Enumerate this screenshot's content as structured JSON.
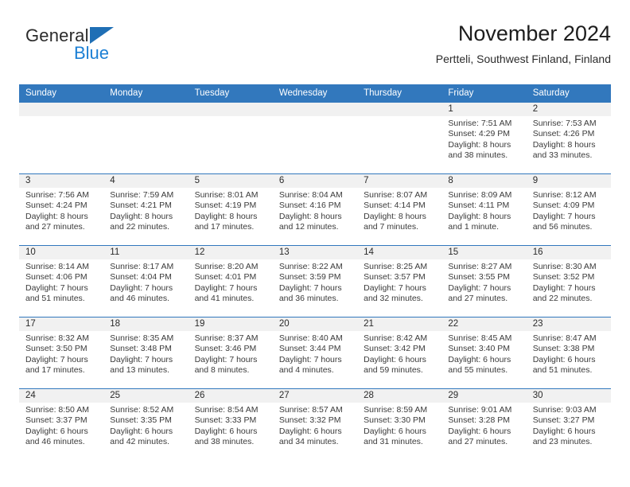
{
  "brand": {
    "name_part1": "General",
    "name_part2": "Blue",
    "accent_color": "#1b7fd4",
    "triangle_color": "#1f6fb5"
  },
  "header": {
    "title": "November 2024",
    "subtitle": "Pertteli, Southwest Finland, Finland"
  },
  "calendar": {
    "header_bg": "#3278bd",
    "day_band_bg": "#f1f1f1",
    "weekdays": [
      "Sunday",
      "Monday",
      "Tuesday",
      "Wednesday",
      "Thursday",
      "Friday",
      "Saturday"
    ],
    "weeks": [
      [
        {
          "day": "",
          "sunrise": "",
          "sunset": "",
          "daylight": ""
        },
        {
          "day": "",
          "sunrise": "",
          "sunset": "",
          "daylight": ""
        },
        {
          "day": "",
          "sunrise": "",
          "sunset": "",
          "daylight": ""
        },
        {
          "day": "",
          "sunrise": "",
          "sunset": "",
          "daylight": ""
        },
        {
          "day": "",
          "sunrise": "",
          "sunset": "",
          "daylight": ""
        },
        {
          "day": "1",
          "sunrise": "Sunrise: 7:51 AM",
          "sunset": "Sunset: 4:29 PM",
          "daylight": "Daylight: 8 hours and 38 minutes."
        },
        {
          "day": "2",
          "sunrise": "Sunrise: 7:53 AM",
          "sunset": "Sunset: 4:26 PM",
          "daylight": "Daylight: 8 hours and 33 minutes."
        }
      ],
      [
        {
          "day": "3",
          "sunrise": "Sunrise: 7:56 AM",
          "sunset": "Sunset: 4:24 PM",
          "daylight": "Daylight: 8 hours and 27 minutes."
        },
        {
          "day": "4",
          "sunrise": "Sunrise: 7:59 AM",
          "sunset": "Sunset: 4:21 PM",
          "daylight": "Daylight: 8 hours and 22 minutes."
        },
        {
          "day": "5",
          "sunrise": "Sunrise: 8:01 AM",
          "sunset": "Sunset: 4:19 PM",
          "daylight": "Daylight: 8 hours and 17 minutes."
        },
        {
          "day": "6",
          "sunrise": "Sunrise: 8:04 AM",
          "sunset": "Sunset: 4:16 PM",
          "daylight": "Daylight: 8 hours and 12 minutes."
        },
        {
          "day": "7",
          "sunrise": "Sunrise: 8:07 AM",
          "sunset": "Sunset: 4:14 PM",
          "daylight": "Daylight: 8 hours and 7 minutes."
        },
        {
          "day": "8",
          "sunrise": "Sunrise: 8:09 AM",
          "sunset": "Sunset: 4:11 PM",
          "daylight": "Daylight: 8 hours and 1 minute."
        },
        {
          "day": "9",
          "sunrise": "Sunrise: 8:12 AM",
          "sunset": "Sunset: 4:09 PM",
          "daylight": "Daylight: 7 hours and 56 minutes."
        }
      ],
      [
        {
          "day": "10",
          "sunrise": "Sunrise: 8:14 AM",
          "sunset": "Sunset: 4:06 PM",
          "daylight": "Daylight: 7 hours and 51 minutes."
        },
        {
          "day": "11",
          "sunrise": "Sunrise: 8:17 AM",
          "sunset": "Sunset: 4:04 PM",
          "daylight": "Daylight: 7 hours and 46 minutes."
        },
        {
          "day": "12",
          "sunrise": "Sunrise: 8:20 AM",
          "sunset": "Sunset: 4:01 PM",
          "daylight": "Daylight: 7 hours and 41 minutes."
        },
        {
          "day": "13",
          "sunrise": "Sunrise: 8:22 AM",
          "sunset": "Sunset: 3:59 PM",
          "daylight": "Daylight: 7 hours and 36 minutes."
        },
        {
          "day": "14",
          "sunrise": "Sunrise: 8:25 AM",
          "sunset": "Sunset: 3:57 PM",
          "daylight": "Daylight: 7 hours and 32 minutes."
        },
        {
          "day": "15",
          "sunrise": "Sunrise: 8:27 AM",
          "sunset": "Sunset: 3:55 PM",
          "daylight": "Daylight: 7 hours and 27 minutes."
        },
        {
          "day": "16",
          "sunrise": "Sunrise: 8:30 AM",
          "sunset": "Sunset: 3:52 PM",
          "daylight": "Daylight: 7 hours and 22 minutes."
        }
      ],
      [
        {
          "day": "17",
          "sunrise": "Sunrise: 8:32 AM",
          "sunset": "Sunset: 3:50 PM",
          "daylight": "Daylight: 7 hours and 17 minutes."
        },
        {
          "day": "18",
          "sunrise": "Sunrise: 8:35 AM",
          "sunset": "Sunset: 3:48 PM",
          "daylight": "Daylight: 7 hours and 13 minutes."
        },
        {
          "day": "19",
          "sunrise": "Sunrise: 8:37 AM",
          "sunset": "Sunset: 3:46 PM",
          "daylight": "Daylight: 7 hours and 8 minutes."
        },
        {
          "day": "20",
          "sunrise": "Sunrise: 8:40 AM",
          "sunset": "Sunset: 3:44 PM",
          "daylight": "Daylight: 7 hours and 4 minutes."
        },
        {
          "day": "21",
          "sunrise": "Sunrise: 8:42 AM",
          "sunset": "Sunset: 3:42 PM",
          "daylight": "Daylight: 6 hours and 59 minutes."
        },
        {
          "day": "22",
          "sunrise": "Sunrise: 8:45 AM",
          "sunset": "Sunset: 3:40 PM",
          "daylight": "Daylight: 6 hours and 55 minutes."
        },
        {
          "day": "23",
          "sunrise": "Sunrise: 8:47 AM",
          "sunset": "Sunset: 3:38 PM",
          "daylight": "Daylight: 6 hours and 51 minutes."
        }
      ],
      [
        {
          "day": "24",
          "sunrise": "Sunrise: 8:50 AM",
          "sunset": "Sunset: 3:37 PM",
          "daylight": "Daylight: 6 hours and 46 minutes."
        },
        {
          "day": "25",
          "sunrise": "Sunrise: 8:52 AM",
          "sunset": "Sunset: 3:35 PM",
          "daylight": "Daylight: 6 hours and 42 minutes."
        },
        {
          "day": "26",
          "sunrise": "Sunrise: 8:54 AM",
          "sunset": "Sunset: 3:33 PM",
          "daylight": "Daylight: 6 hours and 38 minutes."
        },
        {
          "day": "27",
          "sunrise": "Sunrise: 8:57 AM",
          "sunset": "Sunset: 3:32 PM",
          "daylight": "Daylight: 6 hours and 34 minutes."
        },
        {
          "day": "28",
          "sunrise": "Sunrise: 8:59 AM",
          "sunset": "Sunset: 3:30 PM",
          "daylight": "Daylight: 6 hours and 31 minutes."
        },
        {
          "day": "29",
          "sunrise": "Sunrise: 9:01 AM",
          "sunset": "Sunset: 3:28 PM",
          "daylight": "Daylight: 6 hours and 27 minutes."
        },
        {
          "day": "30",
          "sunrise": "Sunrise: 9:03 AM",
          "sunset": "Sunset: 3:27 PM",
          "daylight": "Daylight: 6 hours and 23 minutes."
        }
      ]
    ]
  }
}
